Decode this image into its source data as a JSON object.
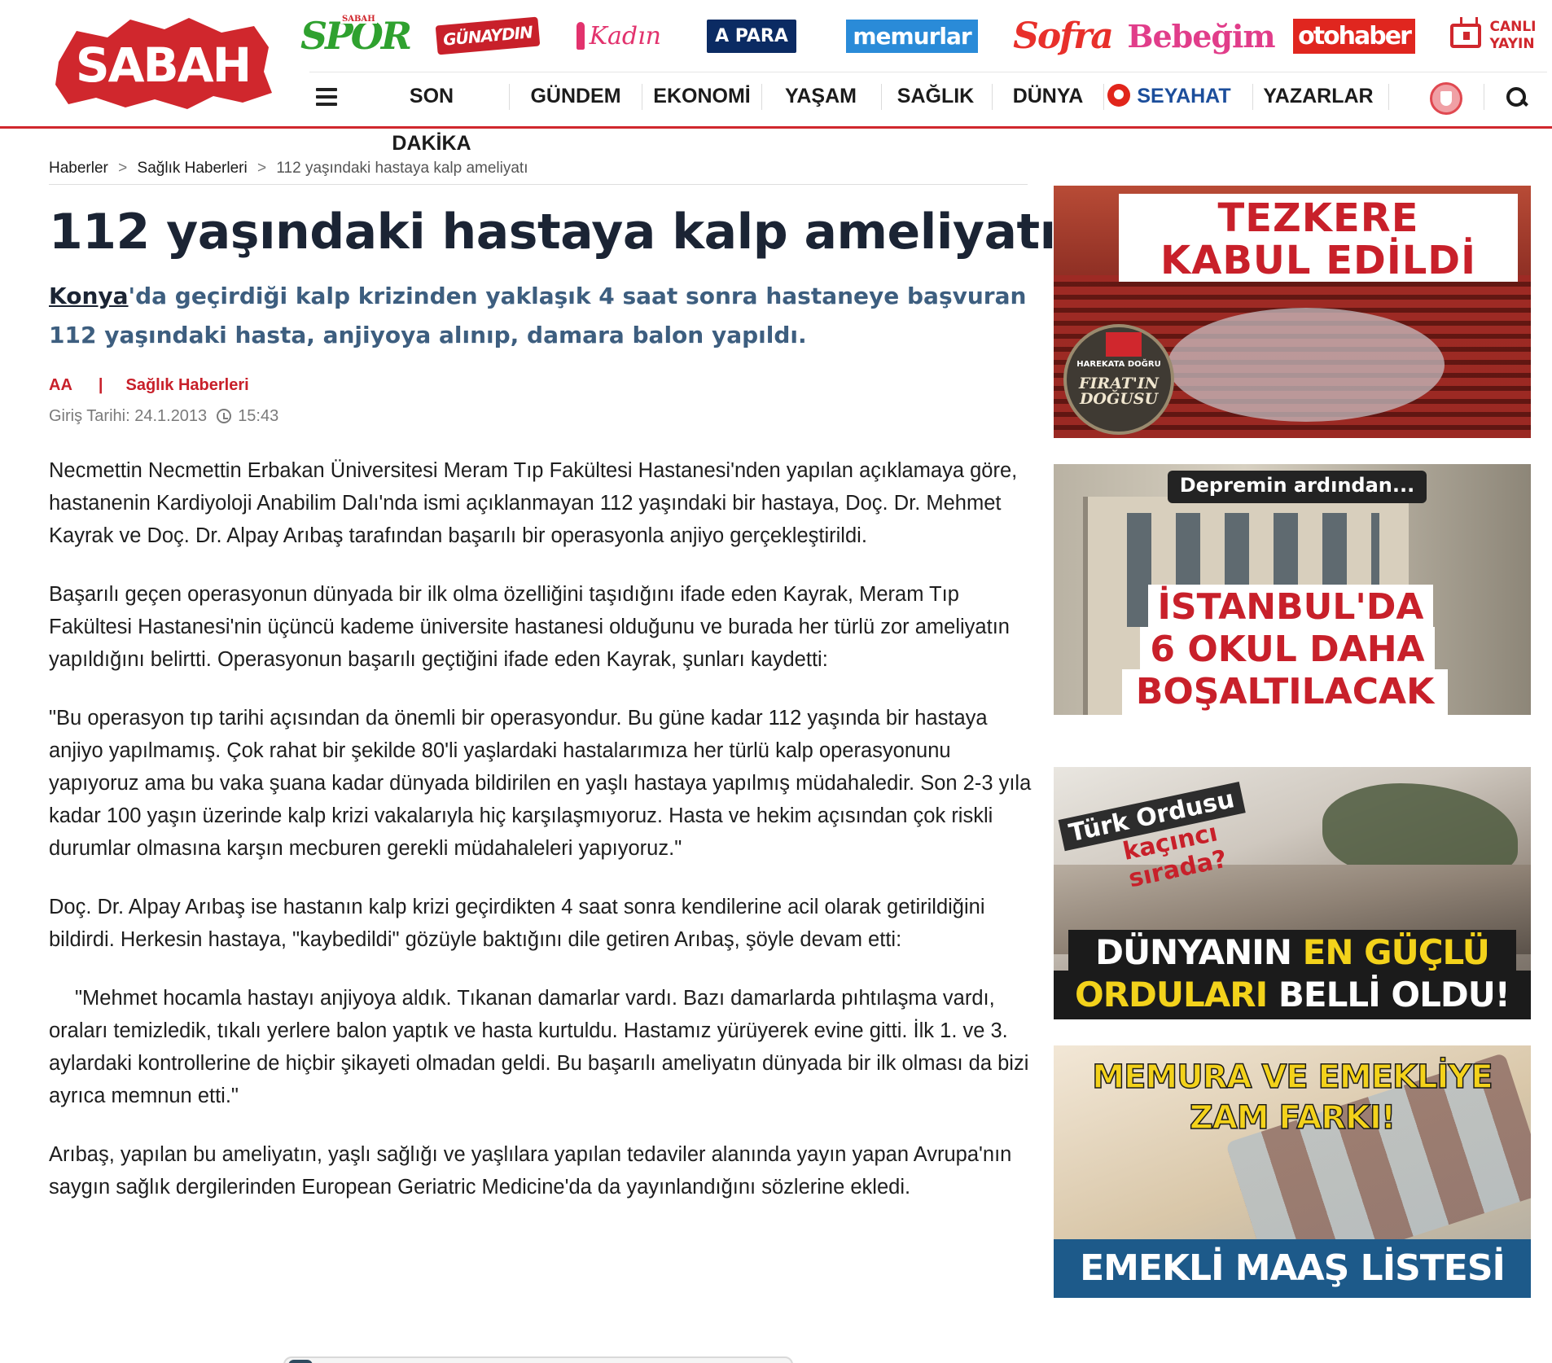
{
  "header": {
    "logo_text": "SABAH",
    "brands": [
      "SPOR",
      "GÜNAYDIN",
      "Kadın",
      "A PARA",
      "memurlar",
      "Sofra",
      "Bebeğim",
      "otohaber"
    ],
    "brand_spor_sub": "SABAH",
    "live": {
      "line1": "CANLI",
      "line2": "YAYIN"
    },
    "accent_color": "#d0272d"
  },
  "nav": {
    "items": [
      "SON DAKİKA",
      "GÜNDEM",
      "EKONOMİ",
      "YAŞAM",
      "SAĞLIK",
      "DÜNYA",
      "SEYAHAT",
      "YAZARLAR"
    ],
    "icons": [
      "menu-icon",
      "thy-icon",
      "fenerbahce-icon",
      "search-icon"
    ]
  },
  "breadcrumb": {
    "items": [
      "Haberler",
      "Sağlık Haberleri",
      "112 yaşındaki hastaya kalp ameliyatı"
    ],
    "separator": ">"
  },
  "article": {
    "title": "112 yaşındaki hastaya kalp ameliyatı",
    "lead_link": "Konya",
    "lead_rest": "'da geçirdiği kalp krizinden yaklaşık 4 saat sonra hastaneye başvuran 112 yaşındaki hasta, anjiyoya alınıp, damara balon yapıldı.",
    "source": "AA",
    "category": "Sağlık Haberleri",
    "pipe": "|",
    "date_label": "Giriş Tarihi: 24.1.2013",
    "time": "15:43",
    "paragraphs": [
      "Necmettin Necmettin Erbakan Üniversitesi Meram Tıp Fakültesi Hastanesi'nden yapılan açıklamaya göre, hastanenin Kardiyoloji Anabilim Dalı'nda ismi açıklanmayan 112 yaşındaki bir hastaya, Doç. Dr. Mehmet Kayrak ve Doç. Dr. Alpay Arıbaş tarafından başarılı bir operasyonla anjiyo gerçekleştirildi.",
      "Başarılı geçen operasyonun dünyada bir ilk olma özelliğini taşıdığını ifade eden Kayrak, Meram Tıp Fakültesi Hastanesi'nin üçüncü kademe üniversite hastanesi olduğunu ve burada her türlü zor ameliyatın yapıldığını belirtti. Operasyonun başarılı geçtiğini ifade eden Kayrak, şunları kaydetti:",
      "\"Bu operasyon tıp tarihi açısından da önemli bir operasyondur. Bu güne kadar 112 yaşında bir hastaya anjiyo yapılmamış. Çok rahat bir şekilde 80'li yaşlardaki hastalarımıza her türlü kalp operasyonunu yapıyoruz ama bu vaka şuana kadar dünyada bildirilen en yaşlı hastaya yapılmış müdahaledir. Son 2-3 yıla kadar 100 yaşın üzerinde kalp krizi vakalarıyla hiç karşılaşmıyoruz. Hasta ve hekim açısından çok riskli durumlar olmasına karşın mecburen gerekli müdahaleleri yapıyoruz.\"",
      "Doç. Dr. Alpay Arıbaş ise hastanın kalp krizi geçirdikten 4 saat sonra kendilerine acil olarak getirildiğini bildirdi. Herkesin hastaya, \"kaybedildi\" gözüyle baktığını dile getiren Arıbaş, şöyle devam etti:",
      "\"Mehmet hocamla hastayı anjiyoya aldık. Tıkanan damarlar vardı. Bazı damarlarda pıhtılaşma vardı, oraları temizledik, tıkalı yerlere balon yaptık ve hasta kurtuldu. Hastamız yürüyerek evine gitti. İlk 1. ve 3. aylardaki kontrollerine de hiçbir şikayeti olmadan geldi. Bu başarılı ameliyatın dünyada bir ilk olması da bizi ayrıca memnun etti.\"",
      "Arıbaş, yapılan bu ameliyatın, yaşlı sağlığı ve yaşlılara yapılan tedaviler alanında yayın yapan Avrupa'nın saygın sağlık dergilerinden European Geriatric Medicine'da da yayınlandığını sözlerine ekledi."
    ]
  },
  "sidebar": {
    "ad1": {
      "line1": "TEZKERE",
      "line2": "KABUL EDİLDİ",
      "badge_top": "HAREKATA DOĞRU",
      "badge_main": "FIRAT'IN DOĞUSU"
    },
    "ad2": {
      "top": "Depremin ardından...",
      "line1": "İSTANBUL'DA",
      "line2": "6 OKUL DAHA",
      "line3": "BOŞALTILACAK"
    },
    "ad3": {
      "q1": "Türk Ordusu",
      "q2": "kaçıncı sırada?",
      "h1a": "DÜNYANIN",
      "h1b": "EN GÜÇLÜ",
      "h2a": "ORDULARI",
      "h2b": "BELLİ OLDU!"
    },
    "ad4": {
      "line1": "MEMURA VE EMEKLİYE",
      "line2": "ZAM FARKI!",
      "line3": "EMEKLİ MAAŞ LİSTESİ"
    }
  }
}
